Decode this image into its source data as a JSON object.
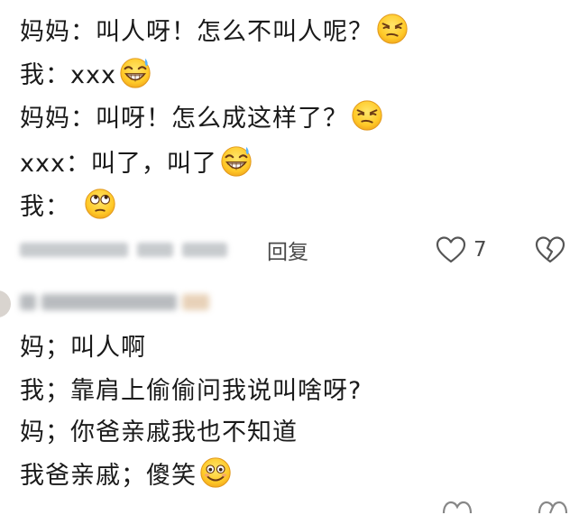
{
  "comment_1": {
    "lines": [
      {
        "text": "妈妈：叫人呀！怎么不叫人呢？",
        "emoji": "smirk-face"
      },
      {
        "text": "我：xxx",
        "emoji": "grin-sweat-face"
      },
      {
        "text": "妈妈：叫呀！怎么成这样了？",
        "emoji": "smirk-face"
      },
      {
        "text": "xxx：叫了，叫了",
        "emoji": "grin-sweat-face"
      },
      {
        "text": "我：",
        "emoji": "eye-roll-face"
      }
    ],
    "actions": {
      "reply_label": "回复",
      "like_count": "7",
      "like_icon": "heart-outline-icon",
      "dislike_icon": "broken-heart-icon"
    }
  },
  "comment_2": {
    "lines": [
      {
        "text": "妈；叫人啊",
        "emoji": ""
      },
      {
        "text": "我；靠肩上偷偷问我说叫啥呀?",
        "emoji": ""
      },
      {
        "text": "妈；你爸亲戚我也不知道",
        "emoji": ""
      },
      {
        "text": "我爸亲戚；傻笑",
        "emoji": "silly-smile-face"
      }
    ]
  },
  "colors": {
    "text": "#1a1a1a",
    "muted": "#4a4a4a",
    "emoji_yellow": "#ffd23f",
    "emoji_orange": "#f4a534"
  }
}
